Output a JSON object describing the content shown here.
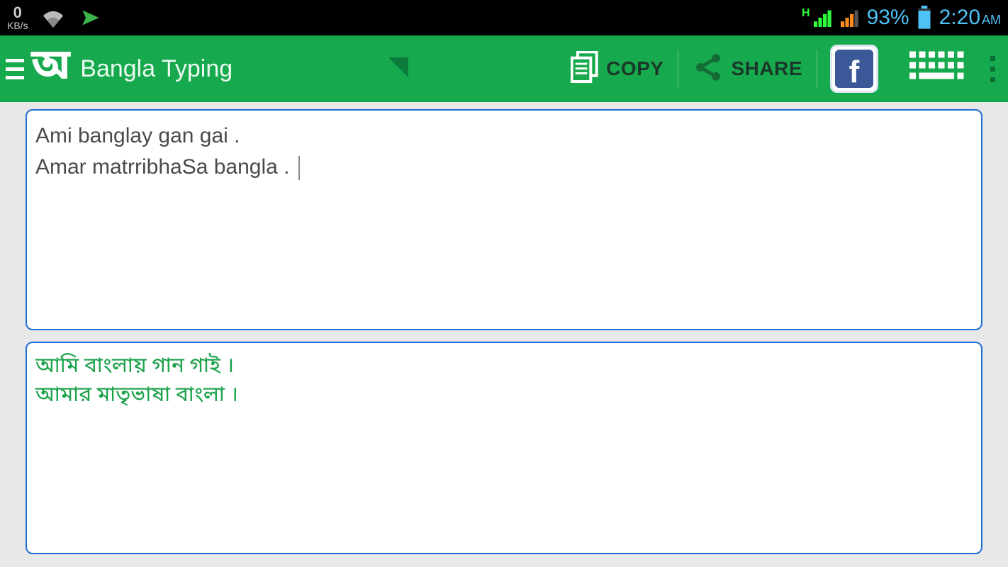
{
  "status": {
    "speed_value": "0",
    "speed_unit": "KB/s",
    "signal_label": "H",
    "battery_pct": "93%",
    "clock_time": "2:20",
    "clock_ampm": "AM"
  },
  "app": {
    "logo_glyph": "অ",
    "title": "Bangla Typing"
  },
  "toolbar": {
    "copy_label": "COPY",
    "share_label": "SHARE"
  },
  "editor": {
    "input_line1": "Ami banglay gan gai  .",
    "input_line2": "Amar matrribhaSa bangla . ",
    "output_line1": "আমি বাংলায় গান গাই  ।",
    "output_line2": "আমার মাতৃভাষা বাংলা ।"
  }
}
